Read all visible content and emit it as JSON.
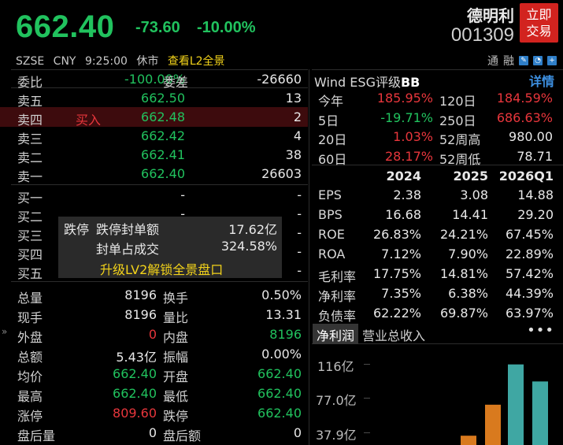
{
  "header": {
    "price": "662.40",
    "change": "-73.60",
    "change_pct": "-10.00%",
    "stock_name": "德明利",
    "stock_code": "001309",
    "trade_button": [
      "立即",
      "交易"
    ],
    "market": "SZSE",
    "currency": "CNY",
    "time": "9:25:00",
    "session_status": "休市",
    "l2_link": "查看L2全景",
    "tools": [
      "通",
      "融"
    ]
  },
  "order_book": {
    "weibi": {
      "label": "委比",
      "value": "-100.00%"
    },
    "weicha": {
      "label": "委差",
      "value": "-26660"
    },
    "asks": [
      {
        "label": "卖五",
        "price": "662.50",
        "volume": "13",
        "tag": ""
      },
      {
        "label": "卖四",
        "price": "662.48",
        "volume": "2",
        "tag": "买入"
      },
      {
        "label": "卖三",
        "price": "662.42",
        "volume": "4",
        "tag": ""
      },
      {
        "label": "卖二",
        "price": "662.41",
        "volume": "38",
        "tag": ""
      },
      {
        "label": "卖一",
        "price": "662.40",
        "volume": "26603",
        "tag": ""
      }
    ],
    "bids": [
      {
        "label": "买一",
        "price": "-",
        "volume": "-"
      },
      {
        "label": "买二",
        "price": "-",
        "volume": "-"
      },
      {
        "label": "买三",
        "price": "-",
        "volume": "-"
      },
      {
        "label": "买四",
        "price": "-",
        "volume": "-"
      },
      {
        "label": "买五",
        "price": "-",
        "volume": "-"
      }
    ],
    "overlay": {
      "label1": "跌停",
      "label2": "跌停封单额",
      "value1": "17.62亿",
      "label3": "封单占成交",
      "value2": "324.58%",
      "upgrade": "升级LV2解锁全景盘口"
    }
  },
  "stats": [
    {
      "l1": "总量",
      "v1": "8196",
      "c1": "white",
      "l2": "换手",
      "v2": "0.50%",
      "c2": "white"
    },
    {
      "l1": "现手",
      "v1": "8196",
      "c1": "white",
      "l2": "量比",
      "v2": "13.31",
      "c2": "white"
    },
    {
      "l1": "外盘",
      "v1": "0",
      "c1": "red",
      "l2": "内盘",
      "v2": "8196",
      "c2": "green"
    },
    {
      "l1": "总额",
      "v1": "5.43亿",
      "c1": "white",
      "l2": "振幅",
      "v2": "0.00%",
      "c2": "white"
    },
    {
      "l1": "均价",
      "v1": "662.40",
      "c1": "green",
      "l2": "开盘",
      "v2": "662.40",
      "c2": "green"
    },
    {
      "l1": "最高",
      "v1": "662.40",
      "c1": "green",
      "l2": "最低",
      "v2": "662.40",
      "c2": "green"
    },
    {
      "l1": "涨停",
      "v1": "809.60",
      "c1": "red",
      "l2": "跌停",
      "v2": "662.40",
      "c2": "green"
    },
    {
      "l1": "盘后量",
      "v1": "0",
      "c1": "white",
      "l2": "盘后额",
      "v2": "0",
      "c2": "white"
    }
  ],
  "esg": {
    "prefix": "Wind ESG评级",
    "rating": "BB",
    "detail": "详情"
  },
  "performance": [
    {
      "l1": "今年",
      "v1": "185.95%",
      "c1": "red",
      "l2": "120日",
      "v2": "184.59%",
      "c2": "red"
    },
    {
      "l1": "5日",
      "v1": "-19.71%",
      "c1": "green",
      "l2": "250日",
      "v2": "686.63%",
      "c2": "red"
    },
    {
      "l1": "20日",
      "v1": "1.03%",
      "c1": "red",
      "l2": "52周高",
      "v2": "980.00",
      "c2": "white"
    },
    {
      "l1": "60日",
      "v1": "28.17%",
      "c1": "red",
      "l2": "52周低",
      "v2": "78.71",
      "c2": "white"
    }
  ],
  "financials": {
    "years": [
      "2024",
      "2025",
      "2026Q1"
    ],
    "rows": [
      {
        "label": "EPS",
        "values": [
          "2.38",
          "3.08",
          "14.88"
        ]
      },
      {
        "label": "BPS",
        "values": [
          "16.68",
          "14.41",
          "29.20"
        ]
      },
      {
        "label": "ROE",
        "values": [
          "26.83%",
          "24.21%",
          "67.45%"
        ]
      },
      {
        "label": "ROA",
        "values": [
          "7.12%",
          "7.90%",
          "22.89%"
        ]
      },
      {
        "label": "毛利率",
        "values": [
          "17.75%",
          "14.81%",
          "57.42%"
        ]
      },
      {
        "label": "净利率",
        "values": [
          "7.35%",
          "6.38%",
          "44.39%"
        ]
      },
      {
        "label": "负债率",
        "values": [
          "62.22%",
          "69.87%",
          "63.97%"
        ]
      }
    ]
  },
  "chart_tabs": [
    "净利润",
    "营业总收入"
  ],
  "chart_more": "•••",
  "chart_data": {
    "type": "bar",
    "y_ticks": [
      "116亿",
      "77.0亿",
      "37.9亿"
    ],
    "y_tick_values": [
      116,
      77.0,
      37.9
    ],
    "ylim": [
      0,
      124
    ],
    "series": [
      {
        "color": "#d97a1e",
        "values": [
          12,
          52
        ]
      },
      {
        "color": "#3fa7a3",
        "values": [
          104,
          82
        ]
      }
    ]
  }
}
